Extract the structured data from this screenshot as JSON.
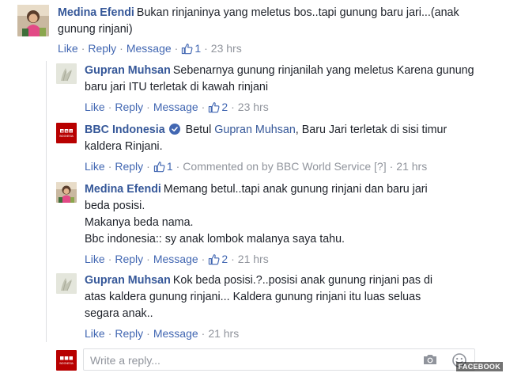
{
  "actions": {
    "like": "Like",
    "reply": "Reply",
    "message": "Message",
    "sep": "·"
  },
  "comments": [
    {
      "author": "Medina Efendi",
      "text": "Bukan rinjaninya yang meletus bos..tapi gunung baru jari...(anak gunung rinjani)",
      "likes": "1",
      "time": "23 hrs"
    },
    {
      "author": "Gupran Muhsan",
      "text": "Sebenarnya gunung rinjanilah yang meletus Karena gunung baru jari ITU terletak di kawah rinjani",
      "likes": "2",
      "time": "23 hrs"
    },
    {
      "author": "BBC Indonesia",
      "mention": "Gupran Muhsan",
      "text_pre": "Betul",
      "text_post": ", Baru Jari terletak di sisi timur kaldera Rinjani.",
      "likes": "1",
      "commented_on": "Commented on by BBC World Service",
      "help": "[?]",
      "time": "21 hrs"
    },
    {
      "author": "Medina Efendi",
      "lines": [
        "Memang betul..tapi anak gunung rinjani dan baru jari beda posisi.",
        "Makanya beda nama.",
        "Bbc indonesia:: sy anak lombok malanya saya tahu."
      ],
      "likes": "2",
      "time": "21 hrs"
    },
    {
      "author": "Gupran Muhsan",
      "text": "Kok beda posisi.?..posisi anak gunung rinjani pas di atas kaldera gunung rinjani... Kaldera gunung rinjani itu luas seluas segara anak..",
      "time": "21 hrs"
    }
  ],
  "reply_box": {
    "placeholder": "Write a reply..."
  },
  "avatar_bbc_text": "BBC",
  "avatar_bbc_sub": "INDONESIA",
  "credit": "FACEBOOK",
  "colors": {
    "link": "#365899",
    "action": "#4267b2",
    "meta": "#90949c",
    "bbc_red": "#b80000"
  }
}
